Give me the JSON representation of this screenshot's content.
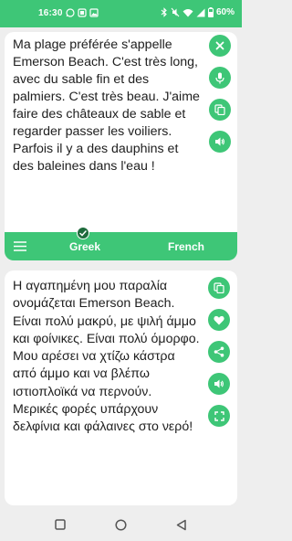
{
  "status_bar": {
    "time": "16:30",
    "battery": "60%",
    "icons": [
      "whatsapp-icon",
      "notification-icon",
      "gallery-icon",
      "bluetooth-icon",
      "mute-icon",
      "wifi-icon",
      "signal-icon",
      "battery-icon"
    ]
  },
  "source": {
    "text": "Ma plage préférée s'appelle Emerson Beach. C'est très long, avec du sable fin et des palmiers. C'est très beau. J'aime faire des châteaux de sable et regarder passer les voiliers. Parfois il y a des dauphins et des baleines dans l'eau !",
    "actions": [
      "close-icon",
      "microphone-icon",
      "copy-icon",
      "speaker-icon"
    ]
  },
  "language_bar": {
    "source_language": "Greek",
    "target_language": "French",
    "selected": "Greek"
  },
  "target": {
    "text": "Η αγαπημένη μου παραλία ονομάζεται Emerson Beach. Είναι πολύ μακρύ, με ψιλή άμμο και φοίνικες. Είναι πολύ όμορφο. Μου αρέσει να χτίζω κάστρα από άμμο και να βλέπω ιστιοπλοϊκά να περνούν. Μερικές φορές υπάρχουν δελφίνια και φάλαινες στο νερό!",
    "actions": [
      "copy-icon",
      "heart-icon",
      "share-icon",
      "speaker-icon",
      "fullscreen-icon"
    ]
  },
  "colors": {
    "accent": "#3ec677",
    "background": "#eeeeee",
    "card": "#ffffff",
    "text": "#202020"
  }
}
